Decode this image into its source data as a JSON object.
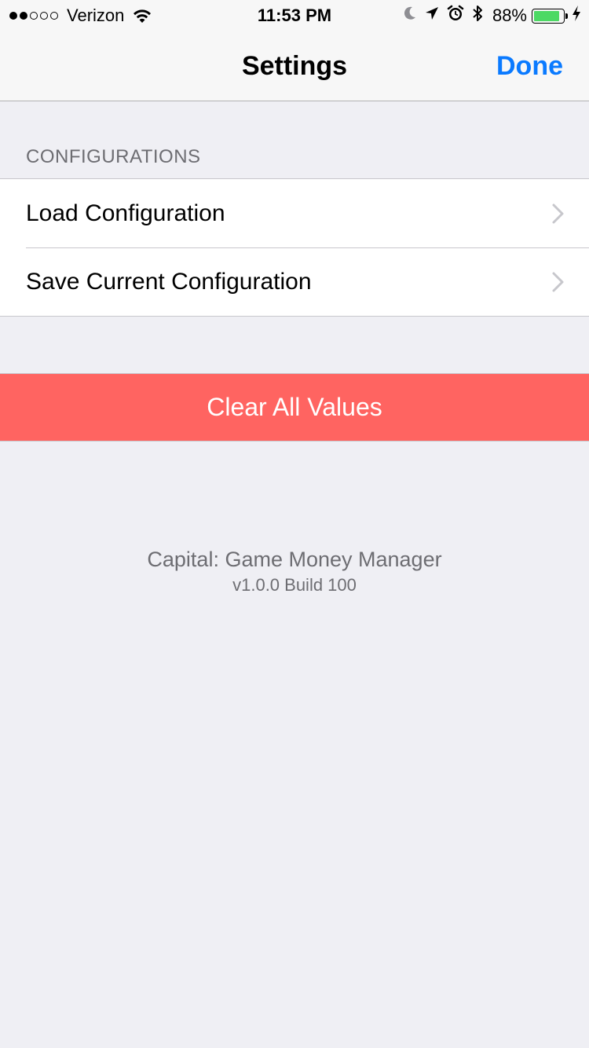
{
  "status_bar": {
    "carrier": "Verizon",
    "signal_bars_filled": 2,
    "signal_bars_total": 5,
    "time": "11:53 PM",
    "battery_percent": "88%",
    "battery_level": 0.88,
    "battery_color": "#4cd964",
    "icons": [
      "wifi-icon",
      "moon-icon",
      "location-arrow-icon",
      "alarm-icon",
      "bluetooth-icon",
      "battery-icon",
      "charging-bolt-icon"
    ]
  },
  "nav": {
    "title": "Settings",
    "done_label": "Done",
    "accent_color": "#0a7aff"
  },
  "configurations": {
    "header": "CONFIGURATIONS",
    "items": [
      {
        "label": "Load Configuration",
        "icon": "chevron-right-icon"
      },
      {
        "label": "Save Current Configuration",
        "icon": "chevron-right-icon"
      }
    ]
  },
  "clear_button": {
    "label": "Clear All Values",
    "color": "#ff6461"
  },
  "footer": {
    "app_name": "Capital: Game Money Manager",
    "version": "v1.0.0 Build 100"
  }
}
